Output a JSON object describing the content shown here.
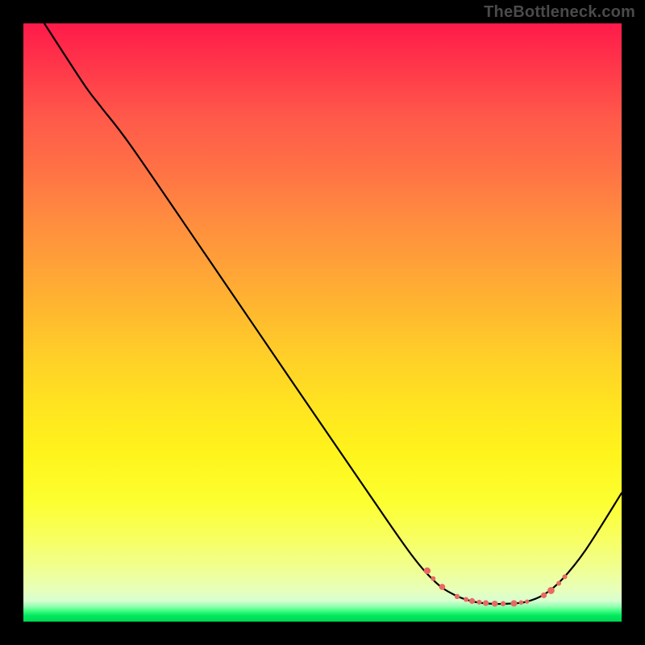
{
  "attribution": "TheBottleneck.com",
  "colors": {
    "curve_stroke": "#000000",
    "marker_fill": "#e96a62",
    "marker_stroke": "#c94a45"
  },
  "chart_data": {
    "type": "line",
    "title": "",
    "xlabel": "",
    "ylabel": "",
    "xlim": [
      0,
      100
    ],
    "ylim": [
      0,
      100
    ],
    "grid": false,
    "curve": [
      {
        "x": 3.5,
        "y": 100
      },
      {
        "x": 10,
        "y": 90
      },
      {
        "x": 13,
        "y": 86
      },
      {
        "x": 18,
        "y": 79.5
      },
      {
        "x": 30,
        "y": 62
      },
      {
        "x": 45,
        "y": 40
      },
      {
        "x": 58,
        "y": 21
      },
      {
        "x": 65,
        "y": 11
      },
      {
        "x": 69,
        "y": 6.5
      },
      {
        "x": 72,
        "y": 4.5
      },
      {
        "x": 75,
        "y": 3.4
      },
      {
        "x": 78,
        "y": 3.0
      },
      {
        "x": 81,
        "y": 3.0
      },
      {
        "x": 84,
        "y": 3.3
      },
      {
        "x": 87,
        "y": 4.5
      },
      {
        "x": 90,
        "y": 7
      },
      {
        "x": 94,
        "y": 12
      },
      {
        "x": 100,
        "y": 21.5
      }
    ],
    "markers": [
      {
        "x": 67.5,
        "y": 8.5,
        "r": 4.2
      },
      {
        "x": 68.5,
        "y": 7.2,
        "r": 3.0
      },
      {
        "x": 70.0,
        "y": 5.8,
        "r": 3.8
      },
      {
        "x": 72.5,
        "y": 4.2,
        "r": 3.2
      },
      {
        "x": 74.0,
        "y": 3.7,
        "r": 3.0
      },
      {
        "x": 75.0,
        "y": 3.45,
        "r": 3.6
      },
      {
        "x": 76.2,
        "y": 3.25,
        "r": 3.0
      },
      {
        "x": 77.3,
        "y": 3.1,
        "r": 3.6
      },
      {
        "x": 78.8,
        "y": 3.0,
        "r": 3.8
      },
      {
        "x": 80.2,
        "y": 3.0,
        "r": 3.2
      },
      {
        "x": 82.0,
        "y": 3.05,
        "r": 4.0
      },
      {
        "x": 83.2,
        "y": 3.2,
        "r": 2.8
      },
      {
        "x": 84.2,
        "y": 3.35,
        "r": 2.6
      },
      {
        "x": 87.0,
        "y": 4.4,
        "r": 3.6
      },
      {
        "x": 88.2,
        "y": 5.2,
        "r": 4.4
      },
      {
        "x": 89.5,
        "y": 6.4,
        "r": 3.0
      },
      {
        "x": 90.5,
        "y": 7.5,
        "r": 3.0
      }
    ]
  }
}
